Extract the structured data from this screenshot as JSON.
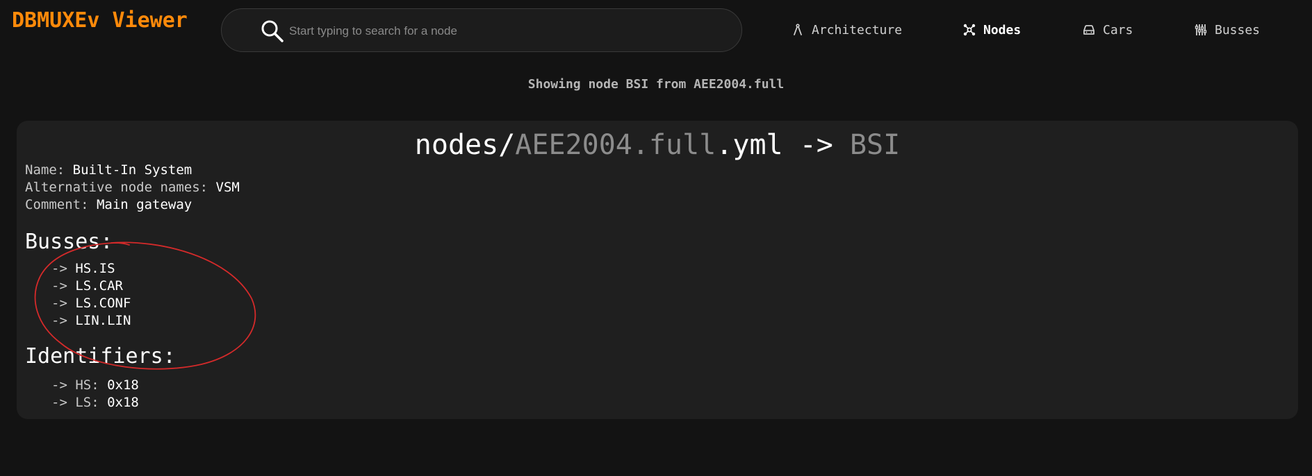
{
  "header": {
    "brand": "DBMUXEv Viewer",
    "search": {
      "placeholder": "Start typing to search for a node",
      "value": "",
      "icon": "search-icon"
    },
    "nav": [
      {
        "label": "Architecture",
        "icon": "architecture-icon",
        "active": false
      },
      {
        "label": "Nodes",
        "icon": "nodes-icon",
        "active": true
      },
      {
        "label": "Cars",
        "icon": "car-icon",
        "active": false
      },
      {
        "label": "Busses",
        "icon": "busses-icon",
        "active": false
      }
    ]
  },
  "subtitle": "Showing node BSI from AEE2004.full",
  "card": {
    "title": {
      "prefix": "nodes/",
      "file": "AEE2004.full",
      "ext": ".yml",
      "separator": " -> ",
      "node": "BSI"
    },
    "fields": {
      "name_label": "Name: ",
      "name_value": "Built-In System",
      "alt_label": "Alternative node names: ",
      "alt_value": "VSM",
      "comment_label": "Comment: ",
      "comment_value": "Main gateway"
    },
    "busses_heading": "Busses:",
    "busses": [
      {
        "arrow": "-> ",
        "name": "HS.IS"
      },
      {
        "arrow": "-> ",
        "name": "LS.CAR"
      },
      {
        "arrow": "-> ",
        "name": "LS.CONF"
      },
      {
        "arrow": "-> ",
        "name": "LIN.LIN"
      }
    ],
    "identifiers_heading": "Identifiers:",
    "identifiers": [
      {
        "arrow": "-> ",
        "bus": "HS: ",
        "value": "0x18"
      },
      {
        "arrow": "-> ",
        "bus": "LS: ",
        "value": "0x18"
      }
    ]
  },
  "colors": {
    "background": "#131313",
    "card": "#1f1f1f",
    "brand": "#ff8a0a",
    "dim_text": "#8c8c8c",
    "annotation": "#d42a2a"
  }
}
